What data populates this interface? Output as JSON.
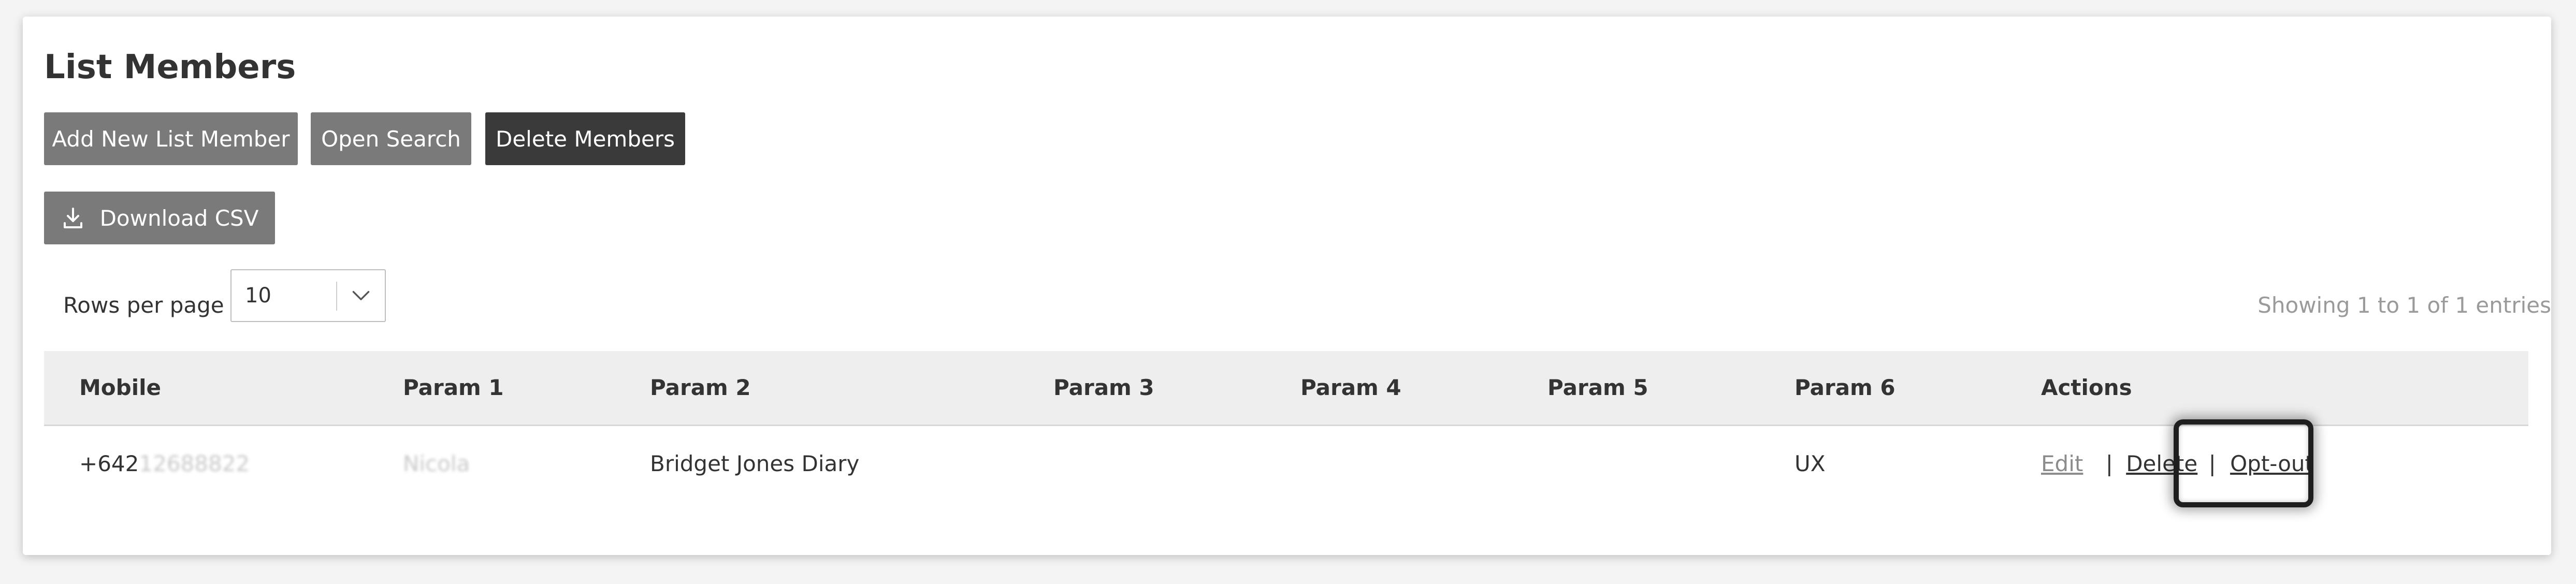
{
  "page": {
    "title": "List Members"
  },
  "toolbar": {
    "add_label": "Add New List Member",
    "search_label": "Open Search",
    "delete_label": "Delete Members",
    "csv_label": "Download CSV",
    "csv_icon": "download-icon"
  },
  "pagination": {
    "rows_label": "Rows per page",
    "rows_value": "10",
    "showing": "Showing 1 to 1 of 1 entries"
  },
  "table": {
    "headers": [
      "Mobile",
      "Param 1",
      "Param 2",
      "Param 3",
      "Param 4",
      "Param 5",
      "Param 6",
      "Actions"
    ],
    "rows": [
      {
        "mobile_prefix": "+642",
        "mobile_hidden": "12688822",
        "param1": "Nicola",
        "param2": "Bridget Jones Diary",
        "param3": "",
        "param4": "",
        "param5": "",
        "param6": "UX",
        "actions": {
          "edit": "Edit",
          "delete": "Delete",
          "optout": "Opt-out",
          "separator": "|"
        }
      }
    ]
  },
  "colors": {
    "button_gray": "#7a7a7a",
    "button_dark": "#3a3a3a",
    "header_bg": "#eeeeee"
  }
}
